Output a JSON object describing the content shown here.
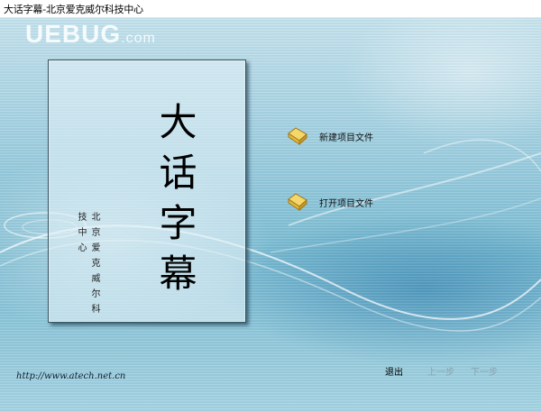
{
  "window": {
    "title": "大话字幕-北京爱克威尔科技中心"
  },
  "watermark": {
    "brand": "UEBUG",
    "suffix": ".com"
  },
  "panel": {
    "title": "大话字幕",
    "company": "北京爱克威尔科技中心"
  },
  "menu": {
    "items": [
      {
        "label": "新建项目文件",
        "icon": "folder-new-icon"
      },
      {
        "label": "打开项目文件",
        "icon": "folder-open-icon"
      }
    ]
  },
  "nav": {
    "exit_label": "退出",
    "prev_label": "上一步",
    "next_label": "下一步"
  },
  "footer": {
    "url": "http://www.atech.net.cn"
  },
  "colors": {
    "background": "#9fcfe0",
    "panel_border": "#3a5560",
    "folder": "#e8c24a",
    "disabled_text": "#8aa3b0"
  }
}
